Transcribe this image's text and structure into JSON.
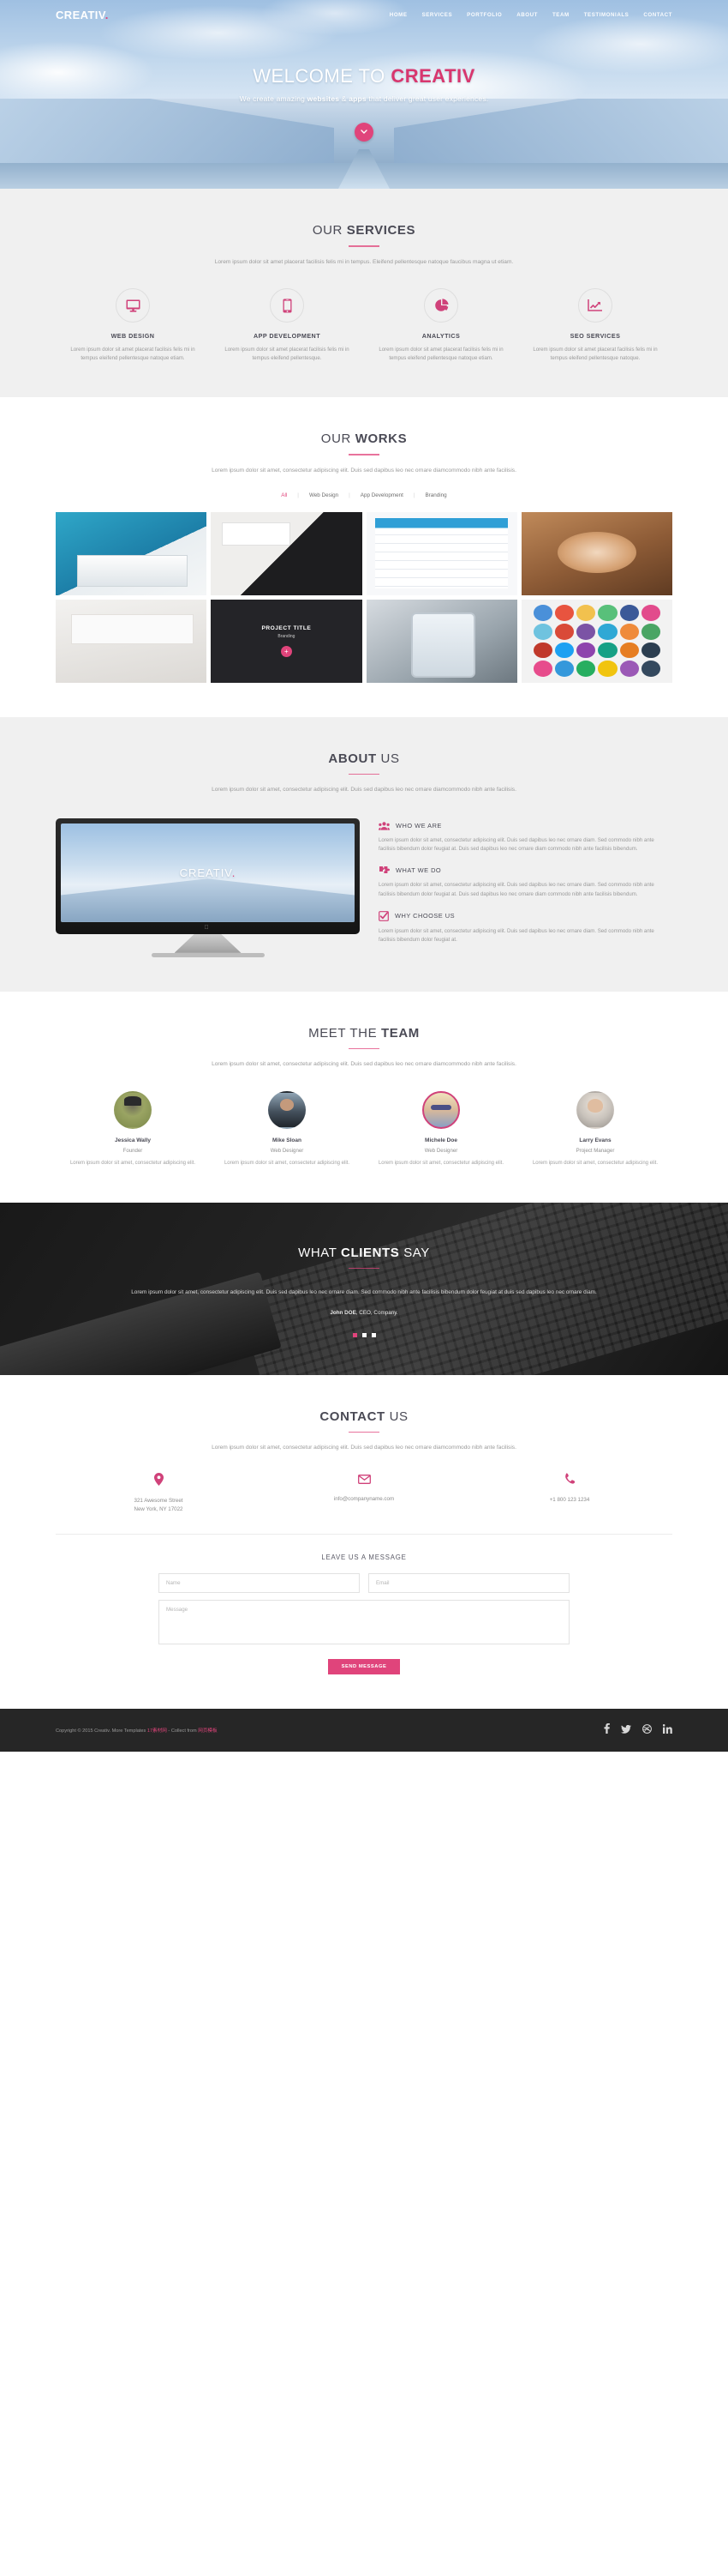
{
  "brand": {
    "name": "CREATIV",
    "dot": "."
  },
  "nav": {
    "items": [
      {
        "label": "HOME"
      },
      {
        "label": "SERVICES"
      },
      {
        "label": "PORTFOLIO"
      },
      {
        "label": "ABOUT"
      },
      {
        "label": "TEAM"
      },
      {
        "label": "TESTIMONIALS"
      },
      {
        "label": "CONTACT"
      }
    ]
  },
  "hero": {
    "title_plain": "WELCOME TO ",
    "title_bold": "CREATIV",
    "sub_a": "We create amazing ",
    "sub_b": "websites",
    "sub_c": " & ",
    "sub_d": "apps",
    "sub_e": " that deliver great user experiences.",
    "scroll_icon": "chevron-down-icon"
  },
  "services": {
    "title_plain": "OUR ",
    "title_bold": "SERVICES",
    "lead": "Lorem ipsum dolor sit amet placerat facilisis felis mi in tempus. Eleifend pellentesque natoque faucibus magna ut etiam.",
    "items": [
      {
        "icon": "monitor-icon",
        "title": "WEB DESIGN",
        "text": "Lorem ipsum dolor sit amet placerat facilisis felis mi in tempus eleifend pellentesque natoque etiam."
      },
      {
        "icon": "mobile-icon",
        "title": "APP DEVELOPMENT",
        "text": "Lorem ipsum dolor sit amet placerat facilisis felis mi in tempus eleifend pellentesque."
      },
      {
        "icon": "pie-chart-icon",
        "title": "ANALYTICS",
        "text": "Lorem ipsum dolor sit amet placerat facilisis felis mi in tempus eleifend pellentesque natoque etiam."
      },
      {
        "icon": "line-chart-icon",
        "title": "SEO SERVICES",
        "text": "Lorem ipsum dolor sit amet placerat facilisis felis mi in tempus eleifend pellentesque natoque."
      }
    ]
  },
  "works": {
    "title_plain": "OUR ",
    "title_bold": "WORKS",
    "lead": "Lorem ipsum dolor sit amet, consectetur adipiscing elit. Duis sed dapibus leo nec ornare diamcommodo nibh ante facilisis.",
    "filters": [
      {
        "label": "All",
        "active": true
      },
      {
        "label": "Web Design",
        "active": false
      },
      {
        "label": "App Development",
        "active": false
      },
      {
        "label": "Branding",
        "active": false
      }
    ],
    "overlay": {
      "title": "PROJECT TITLE",
      "subtitle": "Branding",
      "plus": "+"
    }
  },
  "about": {
    "title_bold": "ABOUT",
    "title_plain": " US",
    "lead": "Lorem ipsum dolor sit amet, consectetur adipiscing elit. Duis sed dapibus leo nec ornare diamcommodo nibh ante facilisis.",
    "screen_text": "CREATIV",
    "screen_dot": ".",
    "items": [
      {
        "icon": "users-icon",
        "title": "WHO WE ARE",
        "text": "Lorem ipsum dolor sit amet, consectetur adipiscing elit. Duis sed dapibus leo nec ornare diam. Sed commodo nibh ante facilisis bibendum dolor feugiat at. Duis sed dapibus leo nec ornare diam commodo nibh ante facilisis bibendum."
      },
      {
        "icon": "puzzle-icon",
        "title": "WHAT WE DO",
        "text": "Lorem ipsum dolor sit amet, consectetur adipiscing elit. Duis sed dapibus leo nec ornare diam. Sed commodo nibh ante facilisis bibendum dolor feugiat at. Duis sed dapibus leo nec ornare diam commodo nibh ante facilisis bibendum."
      },
      {
        "icon": "checkbox-icon",
        "title": "WHY CHOOSE US",
        "text": "Lorem ipsum dolor sit amet, consectetur adipiscing elit. Duis sed dapibus leo nec ornare diam. Sed commodo nibh ante facilisis bibendum dolor feugiat at."
      }
    ]
  },
  "team": {
    "title_plain": "MEET THE ",
    "title_bold": "TEAM",
    "lead": "Lorem ipsum dolor sit amet, consectetur adipiscing elit. Duis sed dapibus leo nec ornare diamcommodo nibh ante facilisis.",
    "members": [
      {
        "name": "Jessica Wally",
        "role": "Founder",
        "bio": "Lorem ipsum dolor sit amet, consectetur adipiscing elit."
      },
      {
        "name": "Mike Sloan",
        "role": "Web Designer",
        "bio": "Lorem ipsum dolor sit amet, consectetur adipiscing elit."
      },
      {
        "name": "Michele Doe",
        "role": "Web Designer",
        "bio": "Lorem ipsum dolor sit amet, consectetur adipiscing elit."
      },
      {
        "name": "Larry Evans",
        "role": "Project Manager",
        "bio": "Lorem ipsum dolor sit amet, consectetur adipiscing elit."
      }
    ]
  },
  "testimonials": {
    "title_plain": "WHAT ",
    "title_bold": "CLIENTS",
    "title_tail": " SAY",
    "quote": "Lorem ipsum dolor sit amet, consectetur adipiscing elit. Duis sed dapibus leo nec ornare diam. Sed commodo nibh ante facilisis bibendum dolor feugiat at duis sed dapibus leo nec ornare diam.",
    "author_bold": "John DOE",
    "author_rest": ", CEO, Company.",
    "dots": 3,
    "active_dot": 0
  },
  "contact": {
    "title_bold": "CONTACT",
    "title_plain": " US",
    "lead": "Lorem ipsum dolor sit amet, consectetur adipiscing elit. Duis sed dapibus leo nec ornare diamcommodo nibh ante facilisis.",
    "info": [
      {
        "icon": "map-pin-icon",
        "line1": "321 Awesome Street",
        "line2": "New York, NY 17022"
      },
      {
        "icon": "envelope-icon",
        "line1": "info@companyname.com",
        "line2": ""
      },
      {
        "icon": "phone-icon",
        "line1": "+1 800 123 1234",
        "line2": ""
      }
    ],
    "form_title": "LEAVE US A MESSAGE",
    "name_placeholder": "Name",
    "name_value": "",
    "email_placeholder": "Email",
    "email_value": "",
    "message_placeholder": "Message",
    "message_value": "",
    "send_label": "SEND MESSAGE"
  },
  "footer": {
    "copy_a": "Copyright © 2015 Creativ. More Templates ",
    "copy_link1": "17素材网",
    "copy_b": " - Collect from ",
    "copy_link2": "网页模板",
    "social": [
      {
        "icon": "facebook-icon",
        "glyph": "f"
      },
      {
        "icon": "twitter-icon",
        "glyph": "t"
      },
      {
        "icon": "dribbble-icon",
        "glyph": "d"
      },
      {
        "icon": "linkedin-icon",
        "glyph": "in"
      }
    ]
  },
  "colors": {
    "accent": "#e0447b",
    "dark": "#1c1c1c",
    "gray_bg": "#f0f0f0",
    "footer_bg": "#262626"
  }
}
